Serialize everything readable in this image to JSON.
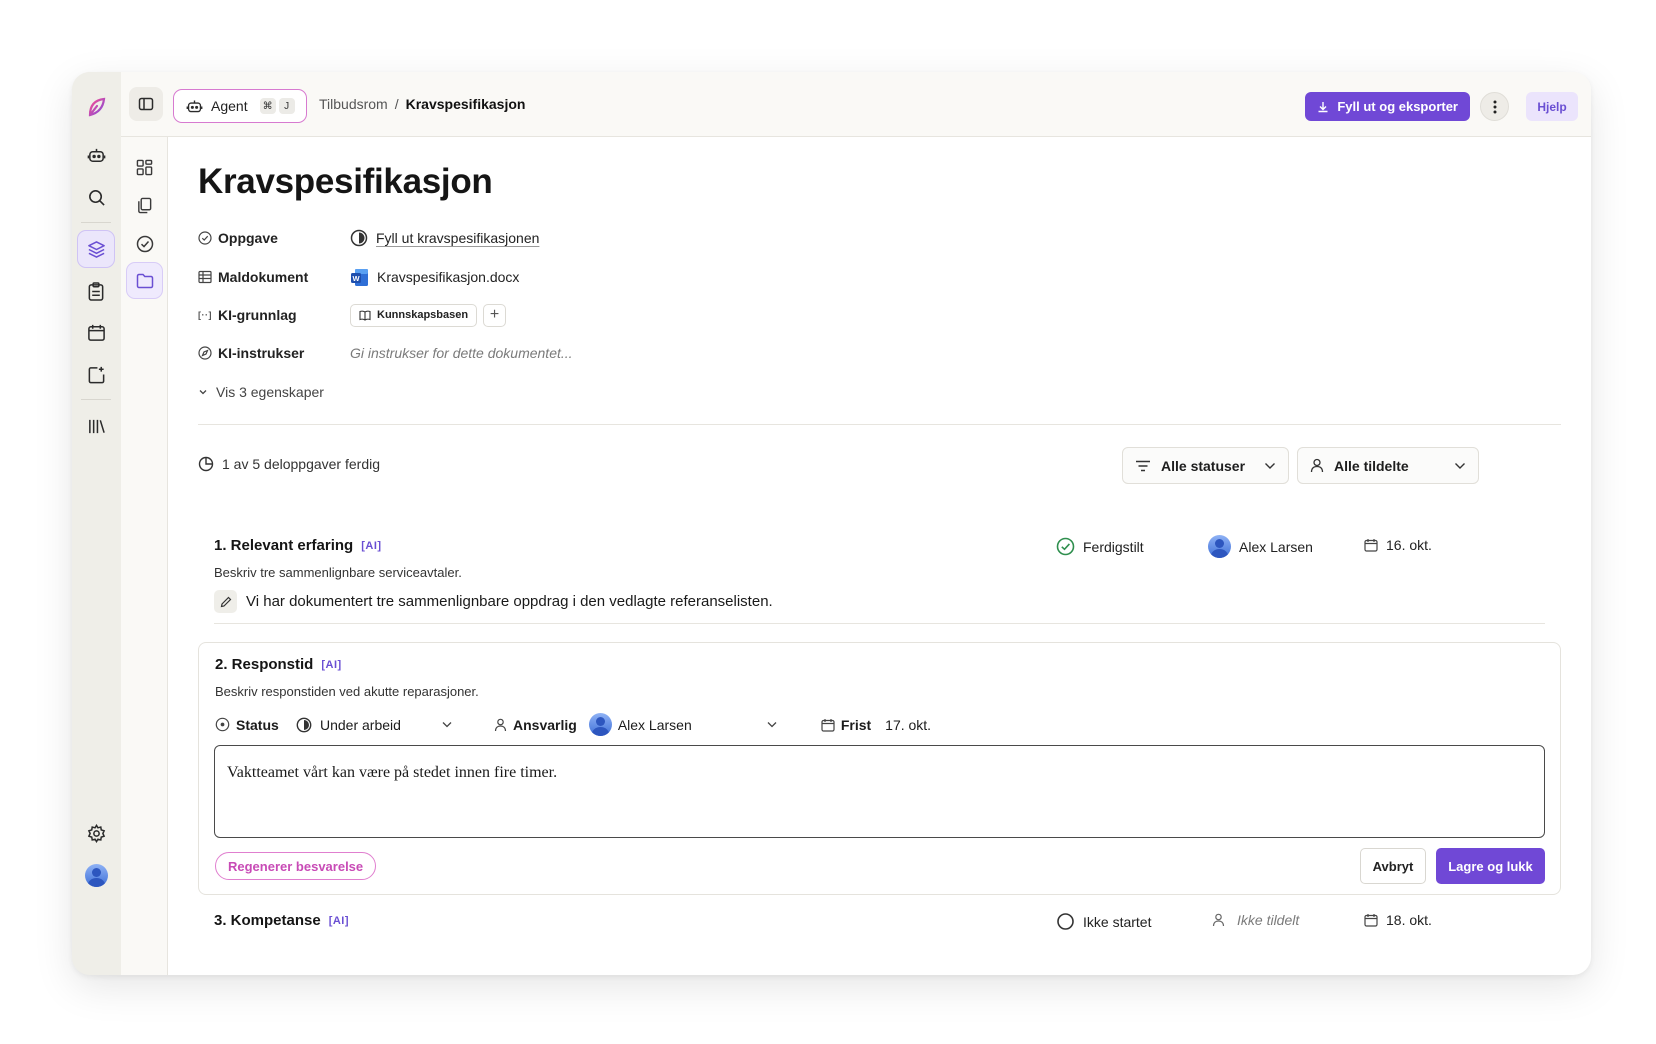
{
  "topbar": {
    "agent_label": "Agent",
    "shortcut_mod": "⌘",
    "shortcut_key": "J",
    "breadcrumb_parent": "Tilbudsrom",
    "breadcrumb_sep": "/",
    "breadcrumb_current": "Kravspesifikasjon",
    "export_label": "Fyll ut og eksporter",
    "help_label": "Hjelp"
  },
  "page": {
    "title": "Kravspesifikasjon"
  },
  "properties": {
    "task_label": "Oppgave",
    "task_value": "Fyll ut kravspesifikasjonen",
    "template_label": "Maldokument",
    "template_value": "Kravspesifikasjon.docx",
    "ai_basis_label": "KI-grunnlag",
    "ai_basis_chip": "Kunnskapsbasen",
    "ai_instructions_label": "KI-instrukser",
    "ai_instructions_placeholder": "Gi instrukser for dette dokumentet...",
    "show_more": "Vis 3 egenskaper"
  },
  "progress": {
    "text": "1 av 5 deloppgaver ferdig"
  },
  "filters": {
    "status": "Alle statuser",
    "assignee": "Alle tildelte"
  },
  "ai_mark": "[AI]",
  "tasks": [
    {
      "title": "1. Relevant erfaring",
      "description": "Beskriv tre sammenlignbare serviceavtaler.",
      "status": "Ferdigstilt",
      "assignee": "Alex Larsen",
      "due": "16. okt.",
      "answer": "Vi har dokumentert tre sammenlignbare oppdrag i den vedlagte referanselisten."
    },
    {
      "title": "2. Responstid",
      "description": "Beskriv responstiden ved akutte reparasjoner.",
      "status_label": "Status",
      "status": "Under arbeid",
      "assignee_label": "Ansvarlig",
      "assignee": "Alex Larsen",
      "due_label": "Frist",
      "due": "17. okt.",
      "answer": "Vaktteamet vårt kan være på stedet innen fire timer.",
      "regenerate_label": "Regenerer besvarelse",
      "cancel_label": "Avbryt",
      "save_label": "Lagre og lukk"
    },
    {
      "title": "3. Kompetanse",
      "status": "Ikke startet",
      "assignee": "Ikke tildelt",
      "due": "18. okt."
    }
  ],
  "colors": {
    "accent": "#7048d6",
    "regenerate": "#c84bb6",
    "done": "#2f8f4e"
  }
}
